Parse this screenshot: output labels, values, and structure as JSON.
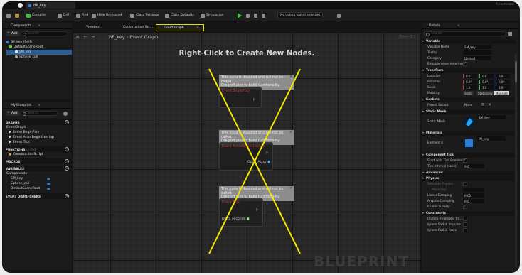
{
  "titlebar": {
    "doc_tab": "BP_key",
    "right_text": "Parent class"
  },
  "toolbar": {
    "compile": "Compile",
    "diff": "Diff",
    "find": "Find",
    "hide_unrelated": "Hide Unrelated",
    "class_settings": "Class Settings",
    "class_defaults": "Class Defaults",
    "simulation": "Simulation",
    "debug_dropdown": "No debug object selected"
  },
  "components": {
    "title": "Components",
    "add": "Add",
    "search_placeholder": "Search",
    "items": [
      "BP_key (Self)",
      "DefaultSceneRoot",
      "SM_key",
      "Sphere_coll"
    ]
  },
  "my_blueprint": {
    "title": "My Blueprint",
    "add": "Add",
    "search_placeholder": "Search",
    "graphs_header": "GRAPHS",
    "event_graph": "EventGraph",
    "events": [
      "Event BeginPlay",
      "Event ActorBeginOverlap",
      "Event Tick"
    ],
    "functions_header": "FUNCTIONS",
    "functions_count": "(1 OVE",
    "construction_script": "ConstructionScript",
    "macros_header": "MACROS",
    "variables_header": "VARIABLES",
    "components_label": "Components",
    "variables": [
      "SM_key",
      "Sphere_coll",
      "DefaultSceneRoot"
    ],
    "dispatchers_header": "EVENT DISPATCHERS"
  },
  "graph_tabs": {
    "viewport": "Viewport",
    "construction": "Construction Scr...",
    "event_graph": "Event Graph"
  },
  "graph": {
    "breadcrumb": "BP_key › Event Graph",
    "zoom": "Zoom 1:1",
    "hint": "Right-Click to Create New Nodes.",
    "watermark": "BLUEPRINT",
    "disabled_note": "This node is disabled and will not be called.\nDrag off pins to build functionality.",
    "nodes": [
      {
        "event": "Event BeginPlay",
        "pins": []
      },
      {
        "event": "Event ActorBeginOverlap",
        "pins": [
          "Other Actor"
        ]
      },
      {
        "event": "Event Tick",
        "pins": [
          "Delta Seconds"
        ]
      }
    ]
  },
  "details": {
    "title": "Details",
    "search_placeholder": "Search",
    "variable_section": "Variable",
    "variable_name_label": "Variable Name",
    "variable_name": "SM_key",
    "tooltip_label": "Tooltip",
    "category_label": "Category",
    "category": "Default",
    "editable_label": "Editable when Inherited",
    "transform_section": "Transform",
    "location_label": "Location",
    "location": [
      "0.0",
      "0.0",
      "0.0"
    ],
    "rotation_label": "Rotation",
    "rotation": [
      "0.0°",
      "0.0°",
      "0.0°"
    ],
    "scale_label": "Scale",
    "scale": [
      "1.0",
      "1.0",
      "1.0"
    ],
    "mobility_label": "Mobility",
    "mobility_options": [
      "Static",
      "Stationary",
      "Movable"
    ],
    "sockets_section": "Sockets",
    "parent_socket_label": "Parent Socket",
    "parent_socket": "None",
    "static_mesh_section": "Static Mesh",
    "static_mesh_label": "Static Mesh",
    "static_mesh_value": "SM_key",
    "materials_section": "Materials",
    "element_label": "Element 0",
    "element_value": "MI_key",
    "component_tick_section": "Component Tick",
    "tick_enabled_label": "Start with Tick Enabled",
    "tick_interval_label": "Tick Interval (secs)",
    "tick_interval": "0.0",
    "advanced_section": "Advanced",
    "physics_section": "Physics",
    "simulate_label": "Simulate Physics",
    "mass_label": "Mass (kg)",
    "linear_damping_label": "Linear Damping",
    "linear_damping": "0.01",
    "angular_damping_label": "Angular Damping",
    "angular_damping": "0.0",
    "gravity_label": "Enable Gravity",
    "constraints_section": "Constraints",
    "update_kinematic_label": "Update Kinematic fro...",
    "ignore_radial_impulse_label": "Ignore Radial Impulse",
    "ignore_radial_force_label": "Ignore Radial Force"
  },
  "colors": {
    "highlight": "#e6e000",
    "selection": "#2d5d92",
    "cross": "#f2e600",
    "variable_bar": "#1e7fe6"
  }
}
